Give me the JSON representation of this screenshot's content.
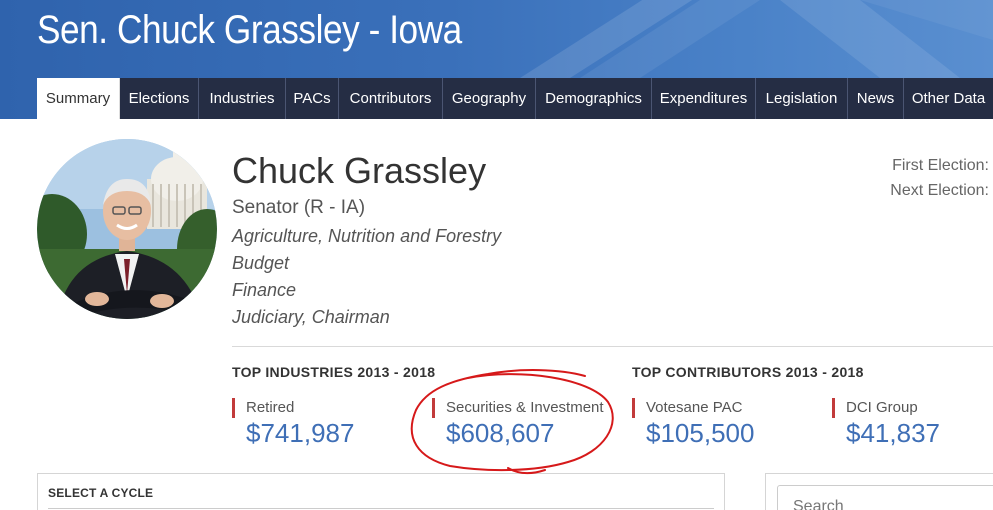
{
  "header": {
    "title": "Sen. Chuck Grassley - Iowa"
  },
  "tabs": [
    {
      "label": "Summary",
      "active": true
    },
    {
      "label": "Elections"
    },
    {
      "label": "Industries"
    },
    {
      "label": "PACs"
    },
    {
      "label": "Contributors"
    },
    {
      "label": "Geography"
    },
    {
      "label": "Demographics"
    },
    {
      "label": "Expenditures"
    },
    {
      "label": "Legislation"
    },
    {
      "label": "News"
    },
    {
      "label": "Other Data"
    }
  ],
  "profile": {
    "name": "Chuck Grassley",
    "role": "Senator (R - IA)",
    "committees": [
      "Agriculture, Nutrition and Forestry",
      "Budget",
      "Finance",
      "Judiciary, Chairman"
    ],
    "first_election_label": "First Election:",
    "next_election_label": "Next Election:"
  },
  "top_industries": {
    "heading": "TOP INDUSTRIES 2013 - 2018",
    "items": [
      {
        "label": "Retired",
        "amount": "$741,987"
      },
      {
        "label": "Securities & Investment",
        "amount": "$608,607"
      }
    ]
  },
  "top_contributors": {
    "heading": "TOP CONTRIBUTORS 2013 - 2018",
    "items": [
      {
        "label": "Votesane PAC",
        "amount": "$105,500"
      },
      {
        "label": "DCI Group",
        "amount": "$41,837"
      }
    ]
  },
  "cycle_panel": {
    "label": "SELECT A CYCLE"
  },
  "search": {
    "placeholder": "Search"
  },
  "colors": {
    "banner": "#3a70ba",
    "tab_bg": "#252d44",
    "accent_bar": "#c23b3b",
    "amount": "#3f6fb6",
    "annotation_circle": "#d6191a"
  }
}
